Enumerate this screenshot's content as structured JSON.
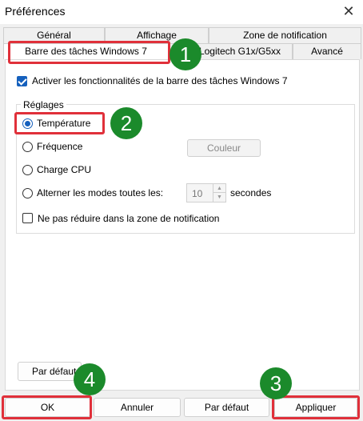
{
  "window": {
    "title": "Préférences"
  },
  "tabs": {
    "row1": [
      "Général",
      "Affichage",
      "Zone de notification"
    ],
    "row2": [
      "Barre des tâches Windows 7",
      "Logitech G1x/G5xx",
      "Avancé"
    ]
  },
  "taskbar": {
    "enable_label": "Activer les fonctionnalités de la barre des tâches Windows 7",
    "enable_checked": true
  },
  "settings": {
    "group_label": "Réglages",
    "options": [
      "Température",
      "Fréquence",
      "Charge CPU",
      "Alterner les modes toutes les:"
    ],
    "selected": "Température",
    "color_button": "Couleur",
    "interval_value": "10",
    "interval_unit": "secondes",
    "no_minimize_label": "Ne pas réduire dans la zone de notification",
    "no_minimize_checked": false
  },
  "panel_defaults_button": "Par défaut",
  "footer": {
    "ok": "OK",
    "cancel": "Annuler",
    "defaults": "Par défaut",
    "apply": "Appliquer"
  },
  "annotations": [
    "1",
    "2",
    "3",
    "4"
  ],
  "colors": {
    "highlight": "#e0303a",
    "badge": "#1b8a2b",
    "accent": "#1560bd"
  }
}
